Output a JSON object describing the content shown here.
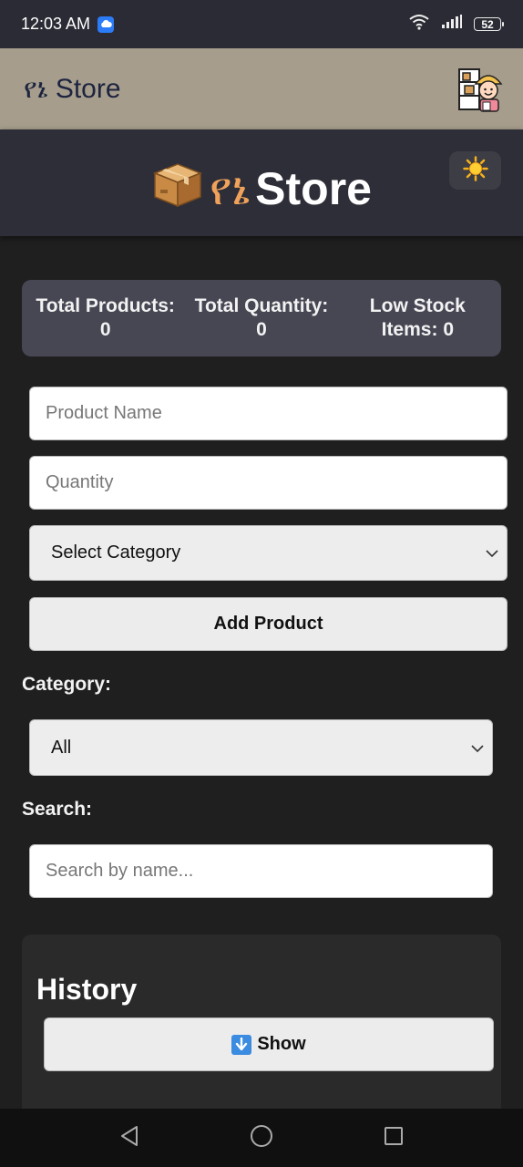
{
  "status_bar": {
    "time": "12:03 AM",
    "battery": "52"
  },
  "app_bar": {
    "title": "የኔ Store"
  },
  "header": {
    "title_emoji": "📦",
    "title_ethiopic": "የኔ",
    "title_text": "Store",
    "theme_toggle_icon": "☀️"
  },
  "stats": {
    "total_products_label": "Total Products:",
    "total_products_value": "0",
    "total_quantity_label": "Total Quantity:",
    "total_quantity_value": "0",
    "low_stock_label": "Low Stock Items:",
    "low_stock_value": "0"
  },
  "form": {
    "product_name_placeholder": "Product Name",
    "quantity_placeholder": "Quantity",
    "category_selected": "Select Category",
    "add_button": "Add Product"
  },
  "filter": {
    "category_label": "Category:",
    "category_selected": "All",
    "search_label": "Search:",
    "search_placeholder": "Search by name..."
  },
  "history": {
    "title": "History",
    "show_button_icon": "⬇",
    "show_button_label": "Show"
  },
  "icons": {
    "cloud": "cloud-icon",
    "wifi": "wifi-icon",
    "signal": "signal-icon",
    "battery": "battery-icon",
    "back": "back-icon",
    "home": "home-icon",
    "recents": "recents-icon"
  }
}
